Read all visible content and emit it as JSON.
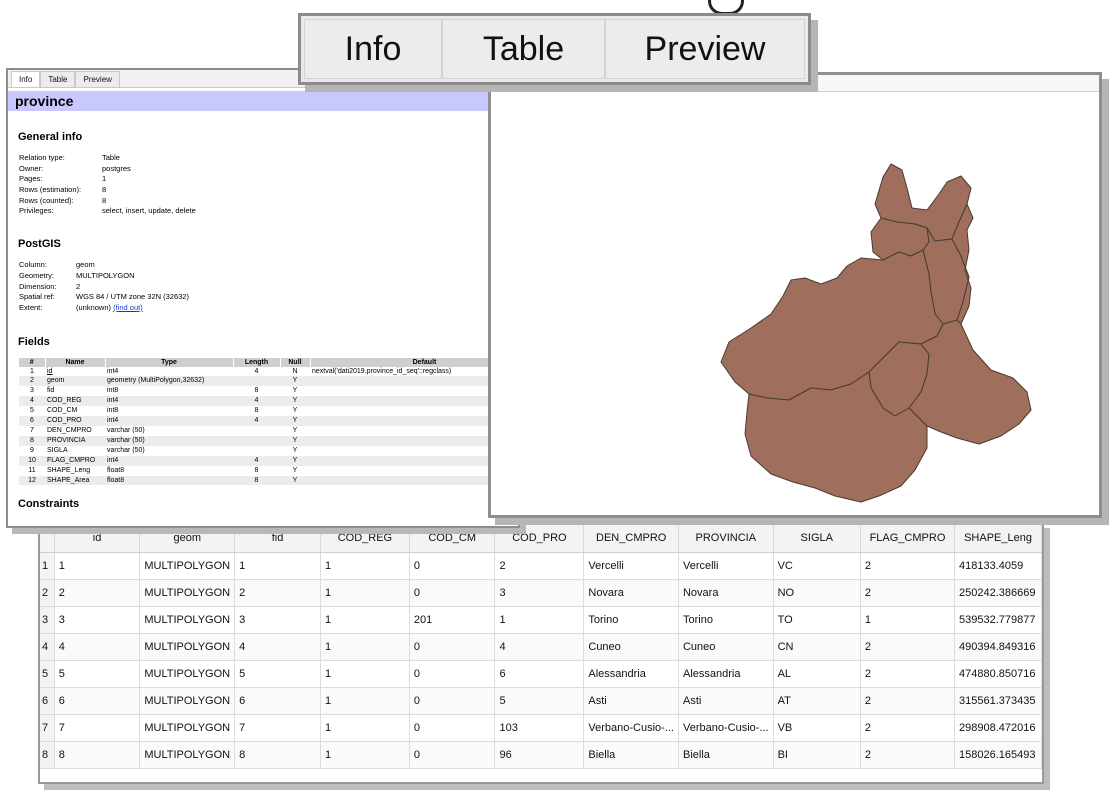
{
  "tab_zoom": {
    "tabs": [
      "Info",
      "Table",
      "Preview"
    ]
  },
  "info": {
    "tabs": [
      "Info",
      "Table",
      "Preview"
    ],
    "relation_title": "province",
    "general_heading": "General info",
    "general": [
      {
        "k": "Relation type:",
        "v": "Table"
      },
      {
        "k": "Owner:",
        "v": "postgres"
      },
      {
        "k": "Pages:",
        "v": "1"
      },
      {
        "k": "Rows (estimation):",
        "v": "8"
      },
      {
        "k": "Rows (counted):",
        "v": "8"
      },
      {
        "k": "Privileges:",
        "v": "select, insert, update, delete"
      }
    ],
    "postgis_heading": "PostGIS",
    "postgis": [
      {
        "k": "Column:",
        "v": "geom"
      },
      {
        "k": "Geometry:",
        "v": "MULTIPOLYGON"
      },
      {
        "k": "Dimension:",
        "v": "2"
      },
      {
        "k": "Spatial ref:",
        "v": "WGS 84 / UTM zone 32N (32632)"
      }
    ],
    "extent_label": "Extent:",
    "extent_value": "(unknown)",
    "extent_link": "(find out)",
    "fields_heading": "Fields",
    "fields_columns": [
      "#",
      "Name",
      "Type",
      "Length",
      "Null",
      "Default"
    ],
    "fields": [
      [
        "1",
        "id",
        "int4",
        "4",
        "N",
        "nextval('dati2019.province_id_seq'::regclass)"
      ],
      [
        "2",
        "geom",
        "geometry (MultiPolygon,32632)",
        "",
        "Y",
        ""
      ],
      [
        "3",
        "fid",
        "int8",
        "8",
        "Y",
        ""
      ],
      [
        "4",
        "COD_REG",
        "int4",
        "4",
        "Y",
        ""
      ],
      [
        "5",
        "COD_CM",
        "int8",
        "8",
        "Y",
        ""
      ],
      [
        "6",
        "COD_PRO",
        "int4",
        "4",
        "Y",
        ""
      ],
      [
        "7",
        "DEN_CMPRO",
        "varchar (50)",
        "",
        "Y",
        ""
      ],
      [
        "8",
        "PROVINCIA",
        "varchar (50)",
        "",
        "Y",
        ""
      ],
      [
        "9",
        "SIGLA",
        "varchar (50)",
        "",
        "Y",
        ""
      ],
      [
        "10",
        "FLAG_CMPRO",
        "int4",
        "4",
        "Y",
        ""
      ],
      [
        "11",
        "SHAPE_Leng",
        "float8",
        "8",
        "Y",
        ""
      ],
      [
        "12",
        "SHAPE_Area",
        "float8",
        "8",
        "Y",
        ""
      ]
    ],
    "constraints_heading": "Constraints"
  },
  "attribute_table": {
    "columns": [
      "id",
      "geom",
      "fid",
      "COD_REG",
      "COD_CM",
      "COD_PRO",
      "DEN_CMPRO",
      "PROVINCIA",
      "SIGLA",
      "FLAG_CMPRO",
      "SHAPE_Leng"
    ],
    "rows": [
      [
        "1",
        "1",
        "MULTIPOLYGON",
        "1",
        "1",
        "0",
        "2",
        "Vercelli",
        "Vercelli",
        "VC",
        "2",
        "418133.4059"
      ],
      [
        "2",
        "2",
        "MULTIPOLYGON",
        "2",
        "1",
        "0",
        "3",
        "Novara",
        "Novara",
        "NO",
        "2",
        "250242.386669"
      ],
      [
        "3",
        "3",
        "MULTIPOLYGON",
        "3",
        "1",
        "201",
        "1",
        "Torino",
        "Torino",
        "TO",
        "1",
        "539532.779877"
      ],
      [
        "4",
        "4",
        "MULTIPOLYGON",
        "4",
        "1",
        "0",
        "4",
        "Cuneo",
        "Cuneo",
        "CN",
        "2",
        "490394.849316"
      ],
      [
        "5",
        "5",
        "MULTIPOLYGON",
        "5",
        "1",
        "0",
        "6",
        "Alessandria",
        "Alessandria",
        "AL",
        "2",
        "474880.850716"
      ],
      [
        "6",
        "6",
        "MULTIPOLYGON",
        "6",
        "1",
        "0",
        "5",
        "Asti",
        "Asti",
        "AT",
        "2",
        "315561.373435"
      ],
      [
        "7",
        "7",
        "MULTIPOLYGON",
        "7",
        "1",
        "0",
        "103",
        "Verbano-Cusio-...",
        "Verbano-Cusio-...",
        "VB",
        "2",
        "298908.472016"
      ],
      [
        "8",
        "8",
        "MULTIPOLYGON",
        "8",
        "1",
        "0",
        "96",
        "Biella",
        "Biella",
        "BI",
        "2",
        "158026.165493"
      ]
    ]
  },
  "preview": {
    "fill_color": "#a06e5c",
    "stroke_color": "#4a3a33"
  }
}
